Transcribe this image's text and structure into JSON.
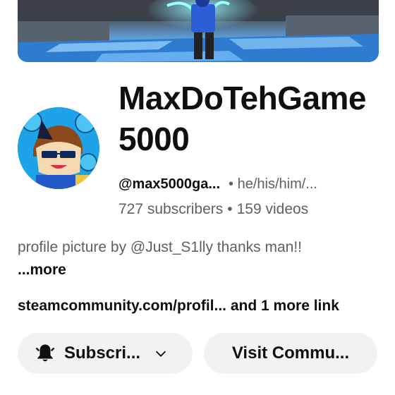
{
  "channel": {
    "name": "MaxDoTehGame5000",
    "handle": "@max5000ga...",
    "pronouns": "• he/his/him/...",
    "subscribers": "727 subscribers",
    "separator": "•",
    "videos": "159 videos"
  },
  "description": {
    "text": "profile picture by @Just_S1lly thanks man!! ",
    "more_label": "...more"
  },
  "links": {
    "primary": "steamcommunity.com/profil...",
    "more": " and 1 more link"
  },
  "buttons": {
    "subscribe_label": "Subscri...",
    "community_label": "Visit Commu..."
  },
  "icons": {
    "bell": "bell-icon",
    "chevron": "chevron-down-icon"
  },
  "colors": {
    "primary_text": "#0f0f0f",
    "secondary_text": "#606060",
    "button_bg": "#f2f2f2"
  }
}
